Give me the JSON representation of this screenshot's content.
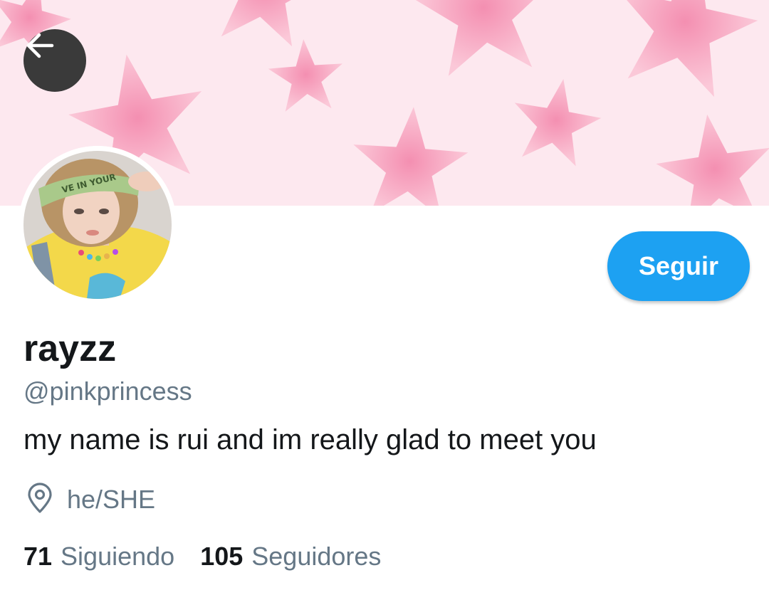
{
  "profile": {
    "display_name": "rayzz",
    "handle": "@pinkprincess",
    "bio": "my name is rui and im really glad to meet you",
    "location": "he/SHE",
    "follow_label": "Seguir"
  },
  "stats": [
    {
      "count": "71",
      "label": "Siguiendo"
    },
    {
      "count": "105",
      "label": "Seguidores"
    }
  ],
  "icons": {
    "back": "arrow-left-icon",
    "location": "location-pin-icon"
  },
  "colors": {
    "accent": "#1da1f2",
    "banner_background": "#fde8ef",
    "banner_stars": "#f5a3bd",
    "secondary_text": "#657786",
    "primary_text": "#14171a"
  }
}
